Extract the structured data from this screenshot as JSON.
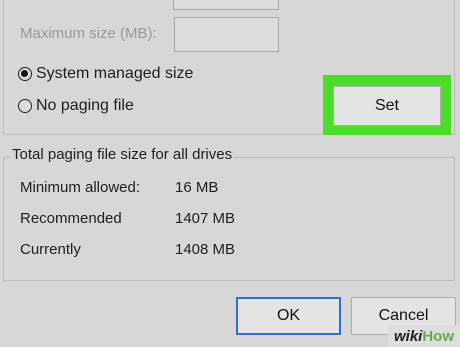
{
  "top_section": {
    "max_size_label": "Maximum size (MB):",
    "max_size_value": ""
  },
  "radios": [
    {
      "label": "System managed size",
      "checked": true
    },
    {
      "label": "No paging file",
      "checked": false
    }
  ],
  "buttons": {
    "set": "Set",
    "ok": "OK",
    "cancel": "Cancel"
  },
  "totals": {
    "title": "Total paging file size for all drives",
    "rows": [
      {
        "label": "Minimum allowed:",
        "value": "16 MB"
      },
      {
        "label": "Recommended",
        "value": "1407 MB"
      },
      {
        "label": "Currently",
        "value": "1408 MB"
      }
    ]
  },
  "watermark": {
    "prefix": "wiki",
    "suffix": "How"
  },
  "colors": {
    "highlight": "#4bde28",
    "ok_border": "#2c6fd0"
  }
}
